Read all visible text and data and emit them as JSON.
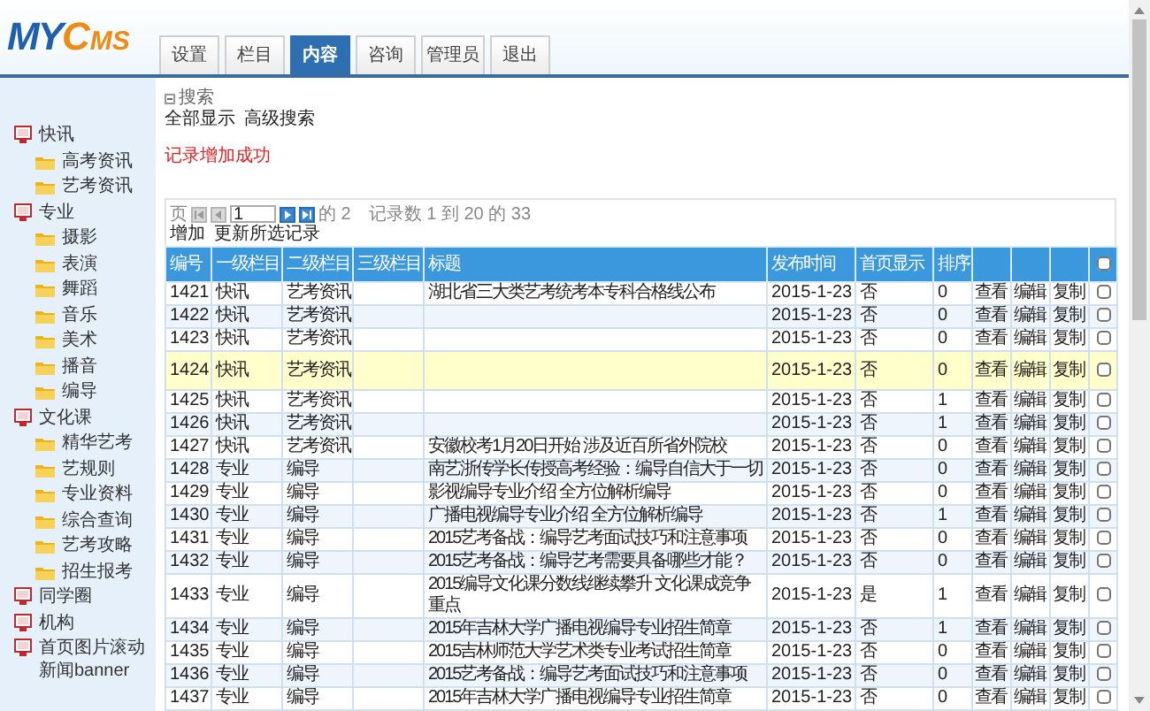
{
  "logo": {
    "first": "MY",
    "initial": "C",
    "rest": "MS"
  },
  "tabs": [
    {
      "label": "设置",
      "selected": false
    },
    {
      "label": "栏目",
      "selected": false
    },
    {
      "label": "内容",
      "selected": true
    },
    {
      "label": "咨询",
      "selected": false
    },
    {
      "label": "管理员",
      "selected": false
    },
    {
      "label": "退出",
      "selected": false
    }
  ],
  "sidebar": {
    "items": [
      {
        "label": "快讯",
        "children": [
          {
            "label": "高考资讯"
          },
          {
            "label": "艺考资讯"
          }
        ]
      },
      {
        "label": "专业",
        "children": [
          {
            "label": "摄影"
          },
          {
            "label": "表演"
          },
          {
            "label": "舞蹈"
          },
          {
            "label": "音乐"
          },
          {
            "label": "美术"
          },
          {
            "label": "播音"
          },
          {
            "label": "编导"
          }
        ]
      },
      {
        "label": "文化课",
        "children": [
          {
            "label": "精华艺考"
          },
          {
            "label": "艺规则"
          },
          {
            "label": "专业资料"
          },
          {
            "label": "综合查询"
          },
          {
            "label": "艺考攻略"
          },
          {
            "label": "招生报考"
          }
        ]
      },
      {
        "label": "同学圈"
      },
      {
        "label": "机构"
      },
      {
        "label": "首页图片滚动新闻banner"
      }
    ]
  },
  "search": {
    "label": "搜索",
    "expanded": true,
    "links": [
      "全部显示",
      "高级搜索"
    ]
  },
  "message": "记录增加成功",
  "pager": {
    "label": "页",
    "page": "1",
    "of_pages": "的 2",
    "records": "记录数 1 到 20 的 33"
  },
  "actions": [
    "增加",
    "更新所选记录"
  ],
  "table": {
    "columns": [
      "编号",
      "一级栏目",
      "二级栏目",
      "三级栏目",
      "标题",
      "发布时间",
      "首页显示",
      "排序"
    ],
    "select_all": {
      "checked": false
    },
    "rows": [
      {
        "cells": [
          "1421",
          "快讯",
          "艺考资讯",
          "",
          "湖北省三大类艺考统考本专科合格线公布",
          "2015-1-23",
          "否",
          "0"
        ],
        "links": [
          "查看",
          "编辑",
          "复制"
        ],
        "checked": false,
        "highlighted": false
      },
      {
        "cells": [
          "1422",
          "快讯",
          "艺考资讯",
          "",
          "",
          "2015-1-23",
          "否",
          "0"
        ],
        "links": [
          "查看",
          "编辑",
          "复制"
        ],
        "checked": false,
        "highlighted": false
      },
      {
        "cells": [
          "1423",
          "快讯",
          "艺考资讯",
          "",
          "",
          "2015-1-23",
          "否",
          "0"
        ],
        "links": [
          "查看",
          "编辑",
          "复制"
        ],
        "checked": false,
        "highlighted": false
      },
      {
        "cells": [
          "1424",
          "快讯",
          "艺考资讯",
          "",
          "",
          "2015-1-23",
          "否",
          "0"
        ],
        "links": [
          "查看",
          "编辑",
          "复制"
        ],
        "checked": false,
        "highlighted": true
      },
      {
        "cells": [
          "1425",
          "快讯",
          "艺考资讯",
          "",
          "",
          "2015-1-23",
          "否",
          "1"
        ],
        "links": [
          "查看",
          "编辑",
          "复制"
        ],
        "checked": false,
        "highlighted": false
      },
      {
        "cells": [
          "1426",
          "快讯",
          "艺考资讯",
          "",
          "",
          "2015-1-23",
          "否",
          "1"
        ],
        "links": [
          "查看",
          "编辑",
          "复制"
        ],
        "checked": false,
        "highlighted": false
      },
      {
        "cells": [
          "1427",
          "快讯",
          "艺考资讯",
          "",
          "安徽校考1月20日开始 涉及近百所省外院校",
          "2015-1-23",
          "否",
          "0"
        ],
        "links": [
          "查看",
          "编辑",
          "复制"
        ],
        "checked": false,
        "highlighted": false
      },
      {
        "cells": [
          "1428",
          "专业",
          "编导",
          "",
          "南艺浙传学长传授高考经验：编导自信大于一切",
          "2015-1-23",
          "否",
          "0"
        ],
        "links": [
          "查看",
          "编辑",
          "复制"
        ],
        "checked": false,
        "highlighted": false
      },
      {
        "cells": [
          "1429",
          "专业",
          "编导",
          "",
          "影视编导专业介绍 全方位解析编导",
          "2015-1-23",
          "否",
          "0"
        ],
        "links": [
          "查看",
          "编辑",
          "复制"
        ],
        "checked": false,
        "highlighted": false
      },
      {
        "cells": [
          "1430",
          "专业",
          "编导",
          "",
          "广播电视编导专业介绍 全方位解析编导",
          "2015-1-23",
          "否",
          "1"
        ],
        "links": [
          "查看",
          "编辑",
          "复制"
        ],
        "checked": false,
        "highlighted": false
      },
      {
        "cells": [
          "1431",
          "专业",
          "编导",
          "",
          "2015艺考备战：编导艺考面试技巧和注意事项",
          "2015-1-23",
          "否",
          "0"
        ],
        "links": [
          "查看",
          "编辑",
          "复制"
        ],
        "checked": false,
        "highlighted": false
      },
      {
        "cells": [
          "1432",
          "专业",
          "编导",
          "",
          "2015艺考备战：编导艺考需要具备哪些才能？",
          "2015-1-23",
          "否",
          "0"
        ],
        "links": [
          "查看",
          "编辑",
          "复制"
        ],
        "checked": false,
        "highlighted": false
      },
      {
        "cells": [
          "1433",
          "专业",
          "编导",
          "",
          "2015编导文化课分数线继续攀升 文化课成竞争重点",
          "2015-1-23",
          "是",
          "1"
        ],
        "links": [
          "查看",
          "编辑",
          "复制"
        ],
        "checked": false,
        "highlighted": false
      },
      {
        "cells": [
          "1434",
          "专业",
          "编导",
          "",
          "2015年吉林大学广播电视编导专业招生简章",
          "2015-1-23",
          "否",
          "1"
        ],
        "links": [
          "查看",
          "编辑",
          "复制"
        ],
        "checked": false,
        "highlighted": false
      },
      {
        "cells": [
          "1435",
          "专业",
          "编导",
          "",
          "2015吉林师范大学艺术类专业考试招生简章",
          "2015-1-23",
          "否",
          "0"
        ],
        "links": [
          "查看",
          "编辑",
          "复制"
        ],
        "checked": false,
        "highlighted": false
      },
      {
        "cells": [
          "1436",
          "专业",
          "编导",
          "",
          "2015艺考备战：编导艺考面试技巧和注意事项",
          "2015-1-23",
          "否",
          "0"
        ],
        "links": [
          "查看",
          "编辑",
          "复制"
        ],
        "checked": false,
        "highlighted": false
      },
      {
        "cells": [
          "1437",
          "专业",
          "编导",
          "",
          "2015年吉林大学广播电视编导专业招生简章",
          "2015-1-23",
          "否",
          "0"
        ],
        "links": [
          "查看",
          "编辑",
          "复制"
        ],
        "checked": false,
        "highlighted": false
      }
    ]
  }
}
